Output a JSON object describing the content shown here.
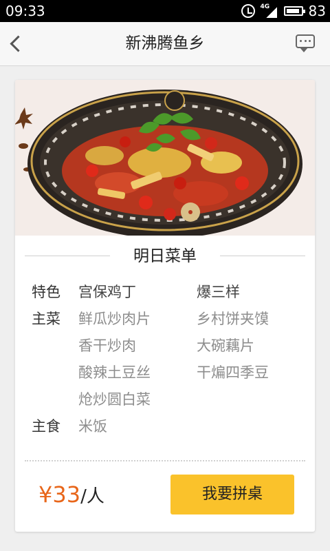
{
  "status_bar": {
    "time": "09:33",
    "network": "4G",
    "battery": "83"
  },
  "header": {
    "title": "新沸腾鱼乡"
  },
  "menu": {
    "section_title": "明日菜单",
    "rows": [
      {
        "label": "特色",
        "col1": "宫保鸡丁",
        "col2": "爆三样"
      },
      {
        "label": "主菜",
        "col1": "鲜瓜炒肉片",
        "col2": "乡村饼夹馍"
      },
      {
        "label": "",
        "col1": "香干炒肉",
        "col2": "大碗藕片"
      },
      {
        "label": "",
        "col1": "酸辣土豆丝",
        "col2": "干煸四季豆"
      },
      {
        "label": "",
        "col1": "炝炒圆白菜",
        "col2": ""
      },
      {
        "label": "主食",
        "col1": "米饭",
        "col2": ""
      }
    ]
  },
  "footer": {
    "currency": "¥",
    "price": "33",
    "unit": "/人",
    "join_button": "我要拼桌"
  },
  "colors": {
    "accent": "#fac22b",
    "price": "#e8661a"
  },
  "icons": [
    "back-arrow-icon",
    "message-icon",
    "alarm-icon",
    "battery-icon"
  ]
}
